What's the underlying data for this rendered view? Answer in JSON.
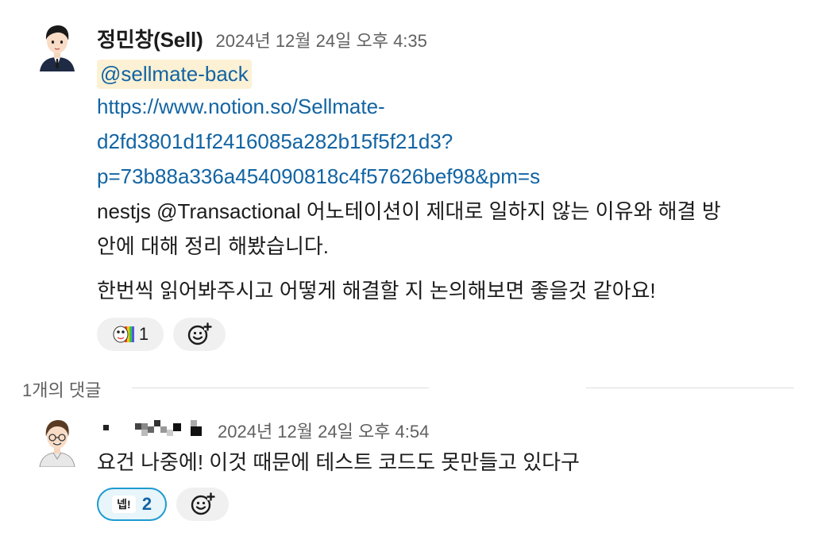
{
  "message": {
    "author": "정민창(Sell)",
    "timestamp": "2024년 12월 24일 오후 4:35",
    "mention": "@sellmate-back",
    "link_lines": [
      "https://www.notion.so/Sellmate-",
      "d2fd3801d1f2416085a282b15f5f21d3?",
      "p=73b88a336a454090818c4f57626bef98&pm=s"
    ],
    "paragraph_1_line_1": "nestjs @Transactional 어노테이션이 제대로 일하지 않는 이유와 해결 방",
    "paragraph_1_line_2": "안에 대해 정리 해봤습니다.",
    "paragraph_2": "한번씩 읽어봐주시고 어떻게 해결할 지 논의해보면 좋을것 같아요!",
    "reactions": [
      {
        "emoji_name": "rainbow-face-emoji",
        "count": "1"
      }
    ]
  },
  "thread_divider": {
    "label": "1개의 댓글"
  },
  "reply": {
    "timestamp": "2024년 12월 24일 오후 4:54",
    "text": "요건 나중에! 이것 때문에 테스트 코드도 못만들고 있다구",
    "reactions": [
      {
        "emoji_label": "넵!",
        "count": "2",
        "active": true
      }
    ]
  },
  "colors": {
    "link": "#1264a3",
    "mention_bg": "#fcf1d4",
    "reaction_bg": "#f0f0f0",
    "reaction_active_border": "#1d9bd1",
    "reaction_active_bg": "#e8f5fa",
    "timestamp": "#616061"
  }
}
